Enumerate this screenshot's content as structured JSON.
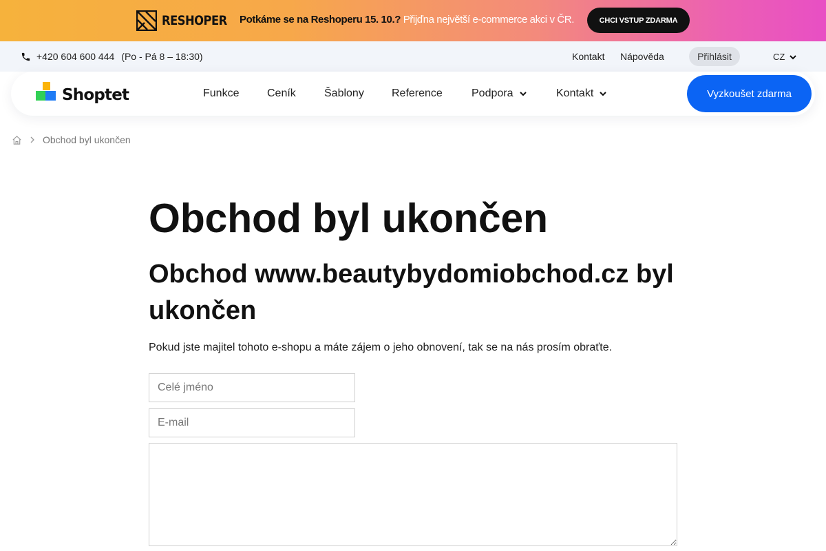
{
  "promo": {
    "brand": "RESHOPER",
    "text_bold": "Potkáme se na Reshoperu 15. 10.?",
    "text_light": " Přijďna největší e-commerce akci v ČR.",
    "button": "CHCI VSTUP ZDARMA"
  },
  "topbar": {
    "phone": "+420 604 600 444",
    "hours": "(Po - Pá 8 – 18:30)",
    "links": [
      "Kontakt",
      "Nápověda"
    ],
    "login": "Přihlásit",
    "language": "CZ"
  },
  "nav": {
    "brand": "Shoptet",
    "items": [
      "Funkce",
      "Ceník",
      "Šablony",
      "Reference",
      "Podpora",
      "Kontakt"
    ],
    "cta": "Vyzkoušet zdarma"
  },
  "breadcrumb": {
    "current": "Obchod byl ukončen"
  },
  "content": {
    "title": "Obchod byl ukončen",
    "subtitle": "Obchod www.beautybydomiobchod.cz byl ukončen",
    "lead": "Pokud jste majitel tohoto e-shopu a máte zájem o jeho obnovení, tak se na nás prosím obraťte."
  },
  "form": {
    "name_placeholder": "Celé jméno",
    "email_placeholder": "E-mail",
    "message_value": ""
  },
  "colors": {
    "accent": "#0b64f4",
    "promo_gradient_start": "#f6b23c",
    "promo_gradient_end": "#e84fc4",
    "topbar_bg": "#f2f5fa"
  }
}
